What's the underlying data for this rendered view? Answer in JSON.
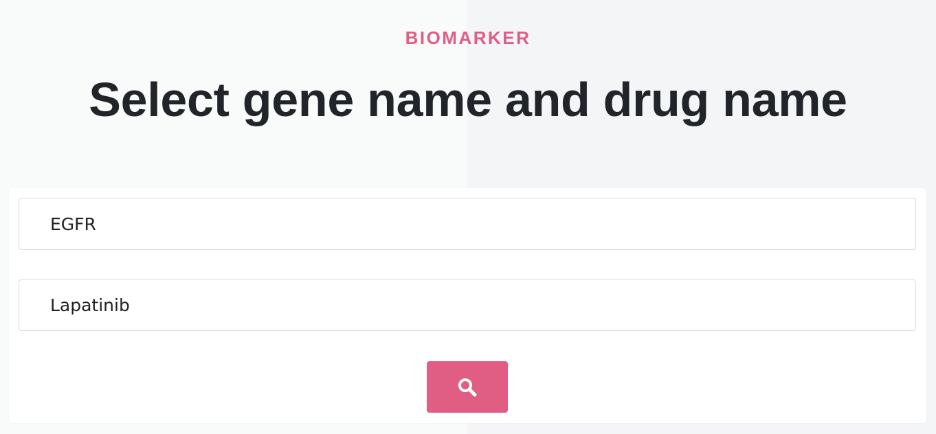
{
  "header": {
    "eyebrow": "BIOMARKER",
    "title": "Select gene name and drug name"
  },
  "form": {
    "gene_value": "EGFR",
    "drug_value": "Lapatinib",
    "search_icon": "search-icon"
  },
  "colors": {
    "accent": "#e05d84",
    "title": "#212529",
    "bg_left": "#f9fbfb",
    "bg_right": "#f4f5f7",
    "field_border": "#d9dadd"
  }
}
